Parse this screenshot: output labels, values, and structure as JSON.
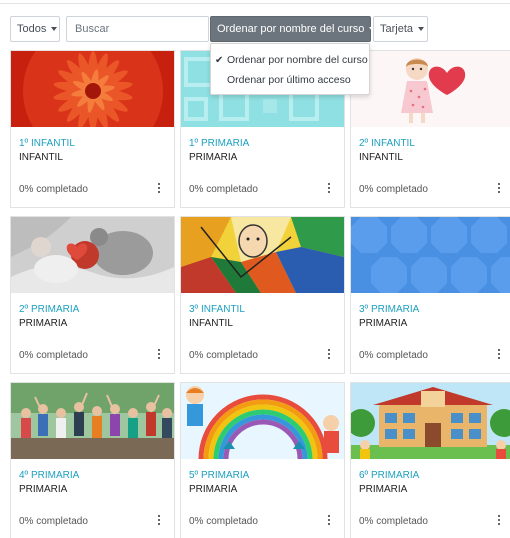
{
  "toolbar": {
    "filter_label": "Todos",
    "search_placeholder": "Buscar",
    "sort_label": "Ordenar por nombre del curso",
    "view_label": "Tarjeta"
  },
  "sort_menu": {
    "items": [
      {
        "label": "Ordenar por nombre del curso",
        "checked": true
      },
      {
        "label": "Ordenar por último acceso",
        "checked": false
      }
    ]
  },
  "courses": [
    {
      "category": "1º INFANTIL",
      "name": "INFANTIL",
      "progress": "0% completado",
      "progress_value": 0,
      "image": "red-flower"
    },
    {
      "category": "1º PRIMARIA",
      "name": "PRIMARIA",
      "progress": "0% completado",
      "progress_value": 0,
      "image": "teal-squares-pattern"
    },
    {
      "category": "2º INFANTIL",
      "name": "INFANTIL",
      "progress": "0% completado",
      "progress_value": 0,
      "image": "girl-with-heart"
    },
    {
      "category": "2º PRIMARIA",
      "name": "PRIMARIA",
      "progress": "0% completado",
      "progress_value": 0,
      "image": "baby-with-teddy"
    },
    {
      "category": "3º INFANTIL",
      "name": "INFANTIL",
      "progress": "0% completado",
      "progress_value": 0,
      "image": "cubist-painting"
    },
    {
      "category": "3º PRIMARIA",
      "name": "PRIMARIA",
      "progress": "0% completado",
      "progress_value": 0,
      "image": "blue-octagon-pattern"
    },
    {
      "category": "4º PRIMARIA",
      "name": "PRIMARIA",
      "progress": "0% completado",
      "progress_value": 0,
      "image": "group-photo-outdoors"
    },
    {
      "category": "5º PRIMARIA",
      "name": "PRIMARIA",
      "progress": "0% completado",
      "progress_value": 0,
      "image": "kids-under-rainbow"
    },
    {
      "category": "6º PRIMARIA",
      "name": "PRIMARIA",
      "progress": "0% completado",
      "progress_value": 0,
      "image": "school-building"
    }
  ],
  "colors": {
    "category_link": "#1b9fbf",
    "sort_button_bg": "#6c757d"
  }
}
